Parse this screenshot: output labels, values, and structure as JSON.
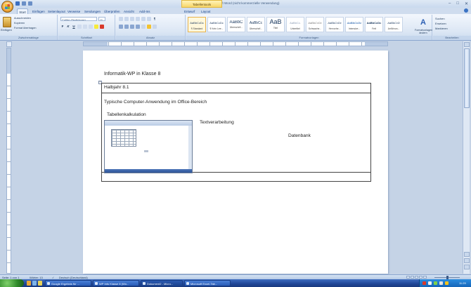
{
  "window": {
    "title": "Dokument2 - Microsoft Word (nicht kommerzielle Verwendung)",
    "context_tab": "Tabellentools",
    "controls": [
      "–",
      "□",
      "✕"
    ]
  },
  "ribbon_tabs": [
    {
      "label": "Start",
      "active": true
    },
    {
      "label": "Einfügen",
      "active": false
    },
    {
      "label": "Seitenlayout",
      "active": false
    },
    {
      "label": "Verweise",
      "active": false
    },
    {
      "label": "Sendungen",
      "active": false
    },
    {
      "label": "Überprüfen",
      "active": false
    },
    {
      "label": "Ansicht",
      "active": false
    },
    {
      "label": "Add-Ins",
      "active": false
    },
    {
      "label": "Entwurf",
      "active": false
    },
    {
      "label": "Layout",
      "active": false
    }
  ],
  "clipboard": {
    "paste": "Einfügen",
    "cut": "Ausschneiden",
    "copy": "Kopieren",
    "format_painter": "Format übertragen",
    "label": "Zwischenablage"
  },
  "font": {
    "name": "Calibri (Textkörper)",
    "size": "11",
    "label": "Schriftart"
  },
  "paragraph": {
    "label": "Absatz"
  },
  "styles": {
    "tiles": [
      {
        "sample": "AaBbCcDc",
        "name": "¶ Standard",
        "selected": true
      },
      {
        "sample": "AaBbCcDc",
        "name": "¶ Kein Lee...",
        "selected": false
      },
      {
        "sample": "AaBbC",
        "name": "Überschrif...",
        "selected": false
      },
      {
        "sample": "AaBbCc",
        "name": "Überschrif...",
        "selected": false
      },
      {
        "sample": "AaB",
        "name": "Titel",
        "selected": false,
        "big": true
      },
      {
        "sample": "AaBbCc.",
        "name": "Untertitel",
        "selected": false
      },
      {
        "sample": "AaBbCcDc",
        "name": "Schwache...",
        "selected": false
      },
      {
        "sample": "AaBbCcDc",
        "name": "Hervorhe...",
        "selected": false
      },
      {
        "sample": "AaBbCcDc",
        "name": "Intensive...",
        "selected": false
      },
      {
        "sample": "AaBbCcDc",
        "name": "Fett",
        "selected": false
      },
      {
        "sample": "AaBbCcD",
        "name": "Anführun...",
        "selected": false
      }
    ],
    "change_styles": "Formatvorlagen ändern",
    "label": "Formatvorlagen"
  },
  "editing": {
    "find": "Suchen",
    "replace": "Ersetzen",
    "select": "Markieren",
    "label": "Bearbeiten"
  },
  "document": {
    "title": "Informatik-WP  in  Klasse 8",
    "table_handle": "+",
    "cells": {
      "row1": "Halbjahr  8.1",
      "row2": "Typische Computer-Anwendung im Office-Bereich",
      "col_a": "Tabellenkalkulation",
      "col_b": "Textverarbeitung",
      "col_c": "Datenbank"
    }
  },
  "statusbar": {
    "page": "Seite: 1 von 1",
    "words": "Wörter: 13",
    "language": "Deutsch (Deutschland)"
  },
  "taskbar": {
    "tasks": [
      "Google Ergebnis für ...",
      "WP Info Klasse 8 (Wo...",
      "Dokument2 - Micro...",
      "Microsoft Excel-Tab..."
    ],
    "clock": "11:29"
  }
}
